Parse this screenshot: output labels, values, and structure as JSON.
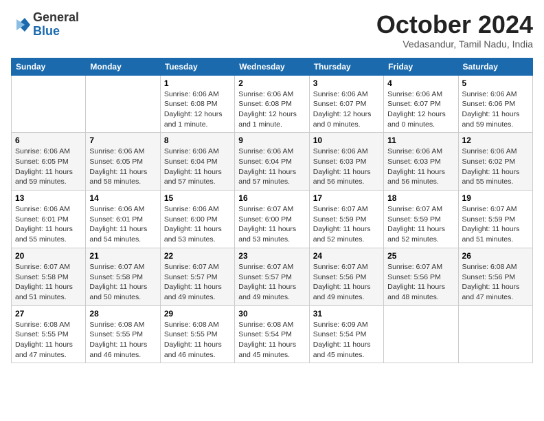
{
  "header": {
    "logo_general": "General",
    "logo_blue": "Blue",
    "month_title": "October 2024",
    "location": "Vedasandur, Tamil Nadu, India"
  },
  "days_of_week": [
    "Sunday",
    "Monday",
    "Tuesday",
    "Wednesday",
    "Thursday",
    "Friday",
    "Saturday"
  ],
  "weeks": [
    [
      {
        "day": "",
        "info": ""
      },
      {
        "day": "",
        "info": ""
      },
      {
        "day": "1",
        "info": "Sunrise: 6:06 AM\nSunset: 6:08 PM\nDaylight: 12 hours and 1 minute."
      },
      {
        "day": "2",
        "info": "Sunrise: 6:06 AM\nSunset: 6:08 PM\nDaylight: 12 hours and 1 minute."
      },
      {
        "day": "3",
        "info": "Sunrise: 6:06 AM\nSunset: 6:07 PM\nDaylight: 12 hours and 0 minutes."
      },
      {
        "day": "4",
        "info": "Sunrise: 6:06 AM\nSunset: 6:07 PM\nDaylight: 12 hours and 0 minutes."
      },
      {
        "day": "5",
        "info": "Sunrise: 6:06 AM\nSunset: 6:06 PM\nDaylight: 11 hours and 59 minutes."
      }
    ],
    [
      {
        "day": "6",
        "info": "Sunrise: 6:06 AM\nSunset: 6:05 PM\nDaylight: 11 hours and 59 minutes."
      },
      {
        "day": "7",
        "info": "Sunrise: 6:06 AM\nSunset: 6:05 PM\nDaylight: 11 hours and 58 minutes."
      },
      {
        "day": "8",
        "info": "Sunrise: 6:06 AM\nSunset: 6:04 PM\nDaylight: 11 hours and 57 minutes."
      },
      {
        "day": "9",
        "info": "Sunrise: 6:06 AM\nSunset: 6:04 PM\nDaylight: 11 hours and 57 minutes."
      },
      {
        "day": "10",
        "info": "Sunrise: 6:06 AM\nSunset: 6:03 PM\nDaylight: 11 hours and 56 minutes."
      },
      {
        "day": "11",
        "info": "Sunrise: 6:06 AM\nSunset: 6:03 PM\nDaylight: 11 hours and 56 minutes."
      },
      {
        "day": "12",
        "info": "Sunrise: 6:06 AM\nSunset: 6:02 PM\nDaylight: 11 hours and 55 minutes."
      }
    ],
    [
      {
        "day": "13",
        "info": "Sunrise: 6:06 AM\nSunset: 6:01 PM\nDaylight: 11 hours and 55 minutes."
      },
      {
        "day": "14",
        "info": "Sunrise: 6:06 AM\nSunset: 6:01 PM\nDaylight: 11 hours and 54 minutes."
      },
      {
        "day": "15",
        "info": "Sunrise: 6:06 AM\nSunset: 6:00 PM\nDaylight: 11 hours and 53 minutes."
      },
      {
        "day": "16",
        "info": "Sunrise: 6:07 AM\nSunset: 6:00 PM\nDaylight: 11 hours and 53 minutes."
      },
      {
        "day": "17",
        "info": "Sunrise: 6:07 AM\nSunset: 5:59 PM\nDaylight: 11 hours and 52 minutes."
      },
      {
        "day": "18",
        "info": "Sunrise: 6:07 AM\nSunset: 5:59 PM\nDaylight: 11 hours and 52 minutes."
      },
      {
        "day": "19",
        "info": "Sunrise: 6:07 AM\nSunset: 5:59 PM\nDaylight: 11 hours and 51 minutes."
      }
    ],
    [
      {
        "day": "20",
        "info": "Sunrise: 6:07 AM\nSunset: 5:58 PM\nDaylight: 11 hours and 51 minutes."
      },
      {
        "day": "21",
        "info": "Sunrise: 6:07 AM\nSunset: 5:58 PM\nDaylight: 11 hours and 50 minutes."
      },
      {
        "day": "22",
        "info": "Sunrise: 6:07 AM\nSunset: 5:57 PM\nDaylight: 11 hours and 49 minutes."
      },
      {
        "day": "23",
        "info": "Sunrise: 6:07 AM\nSunset: 5:57 PM\nDaylight: 11 hours and 49 minutes."
      },
      {
        "day": "24",
        "info": "Sunrise: 6:07 AM\nSunset: 5:56 PM\nDaylight: 11 hours and 49 minutes."
      },
      {
        "day": "25",
        "info": "Sunrise: 6:07 AM\nSunset: 5:56 PM\nDaylight: 11 hours and 48 minutes."
      },
      {
        "day": "26",
        "info": "Sunrise: 6:08 AM\nSunset: 5:56 PM\nDaylight: 11 hours and 47 minutes."
      }
    ],
    [
      {
        "day": "27",
        "info": "Sunrise: 6:08 AM\nSunset: 5:55 PM\nDaylight: 11 hours and 47 minutes."
      },
      {
        "day": "28",
        "info": "Sunrise: 6:08 AM\nSunset: 5:55 PM\nDaylight: 11 hours and 46 minutes."
      },
      {
        "day": "29",
        "info": "Sunrise: 6:08 AM\nSunset: 5:55 PM\nDaylight: 11 hours and 46 minutes."
      },
      {
        "day": "30",
        "info": "Sunrise: 6:08 AM\nSunset: 5:54 PM\nDaylight: 11 hours and 45 minutes."
      },
      {
        "day": "31",
        "info": "Sunrise: 6:09 AM\nSunset: 5:54 PM\nDaylight: 11 hours and 45 minutes."
      },
      {
        "day": "",
        "info": ""
      },
      {
        "day": "",
        "info": ""
      }
    ]
  ]
}
